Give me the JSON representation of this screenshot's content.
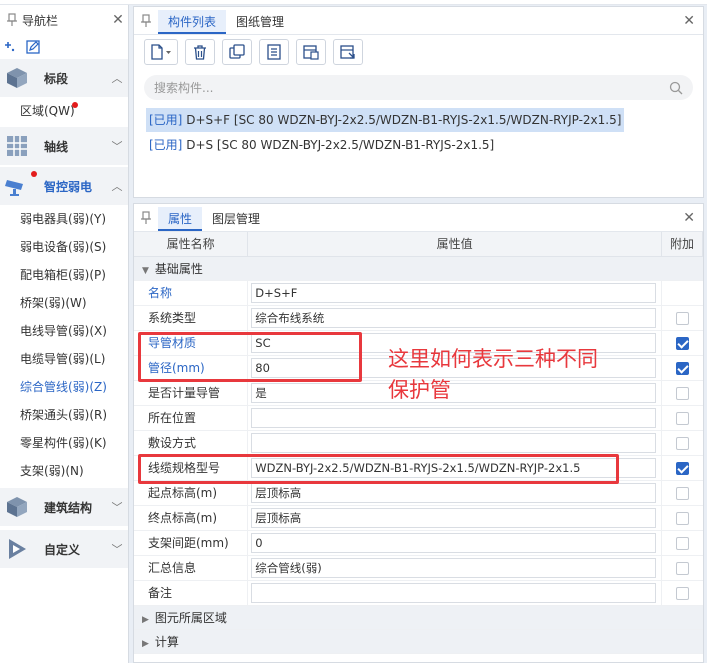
{
  "nav": {
    "title": "导航栏",
    "sections": [
      {
        "label": "标段",
        "expanded": true,
        "items": [
          {
            "label": "区域(QW)",
            "badge": true
          }
        ]
      },
      {
        "label": "轴线",
        "expanded": false,
        "items": []
      },
      {
        "label": "智控弱电",
        "expanded": true,
        "badge": true,
        "items": [
          {
            "label": "弱电器具(弱)(Y)"
          },
          {
            "label": "弱电设备(弱)(S)"
          },
          {
            "label": "配电箱柜(弱)(P)"
          },
          {
            "label": "桥架(弱)(W)"
          },
          {
            "label": "电线导管(弱)(X)"
          },
          {
            "label": "电缆导管(弱)(L)"
          },
          {
            "label": "综合管线(弱)(Z)",
            "active": true
          },
          {
            "label": "桥架通头(弱)(R)"
          },
          {
            "label": "零星构件(弱)(K)"
          },
          {
            "label": "支架(弱)(N)"
          }
        ]
      },
      {
        "label": "建筑结构",
        "expanded": false,
        "items": []
      },
      {
        "label": "自定义",
        "expanded": false,
        "items": []
      }
    ]
  },
  "components": {
    "tabs": [
      "构件列表",
      "图纸管理"
    ],
    "active_tab": "构件列表",
    "search_placeholder": "搜索构件...",
    "items": [
      {
        "tag": "[已用]",
        "text": "D+S+F [SC 80 WDZN-BYJ-2x2.5/WDZN-B1-RYJS-2x1.5/WDZN-RYJP-2x1.5]",
        "selected": true
      },
      {
        "tag": "[已用]",
        "text": "D+S [SC 80 WDZN-BYJ-2x2.5/WDZN-B1-RYJS-2x1.5]",
        "selected": false
      }
    ]
  },
  "properties": {
    "tabs": [
      "属性",
      "图层管理"
    ],
    "active_tab": "属性",
    "columns": [
      "属性名称",
      "属性值",
      "附加"
    ],
    "group_basic": "基础属性",
    "rows": [
      {
        "name": "名称",
        "value": "D+S+F",
        "blue": true,
        "check": null
      },
      {
        "name": "系统类型",
        "value": "综合布线系统",
        "blue": false,
        "check": false
      },
      {
        "name": "导管材质",
        "value": "SC",
        "blue": true,
        "check": true
      },
      {
        "name": "管径(mm)",
        "value": "80",
        "blue": true,
        "check": true
      },
      {
        "name": "是否计量导管",
        "value": "是",
        "blue": false,
        "check": false
      },
      {
        "name": "所在位置",
        "value": "",
        "blue": false,
        "check": false
      },
      {
        "name": "敷设方式",
        "value": "",
        "blue": false,
        "check": false
      },
      {
        "name": "线缆规格型号",
        "value": "WDZN-BYJ-2x2.5/WDZN-B1-RYJS-2x1.5/WDZN-RYJP-2x1.5",
        "blue": false,
        "check": true
      },
      {
        "name": "起点标高(m)",
        "value": "层顶标高",
        "blue": false,
        "check": false
      },
      {
        "name": "终点标高(m)",
        "value": "层顶标高",
        "blue": false,
        "check": false
      },
      {
        "name": "支架间距(mm)",
        "value": "0",
        "blue": false,
        "check": false
      },
      {
        "name": "汇总信息",
        "value": "综合管线(弱)",
        "blue": false,
        "check": false
      },
      {
        "name": "备注",
        "value": "",
        "blue": false,
        "check": false
      }
    ],
    "group_region": "图元所属区域",
    "group_calc": "计算"
  },
  "annotation": {
    "text_line1": "这里如何表示三种不同",
    "text_line2": "保护管",
    "color": "#e8383d"
  }
}
